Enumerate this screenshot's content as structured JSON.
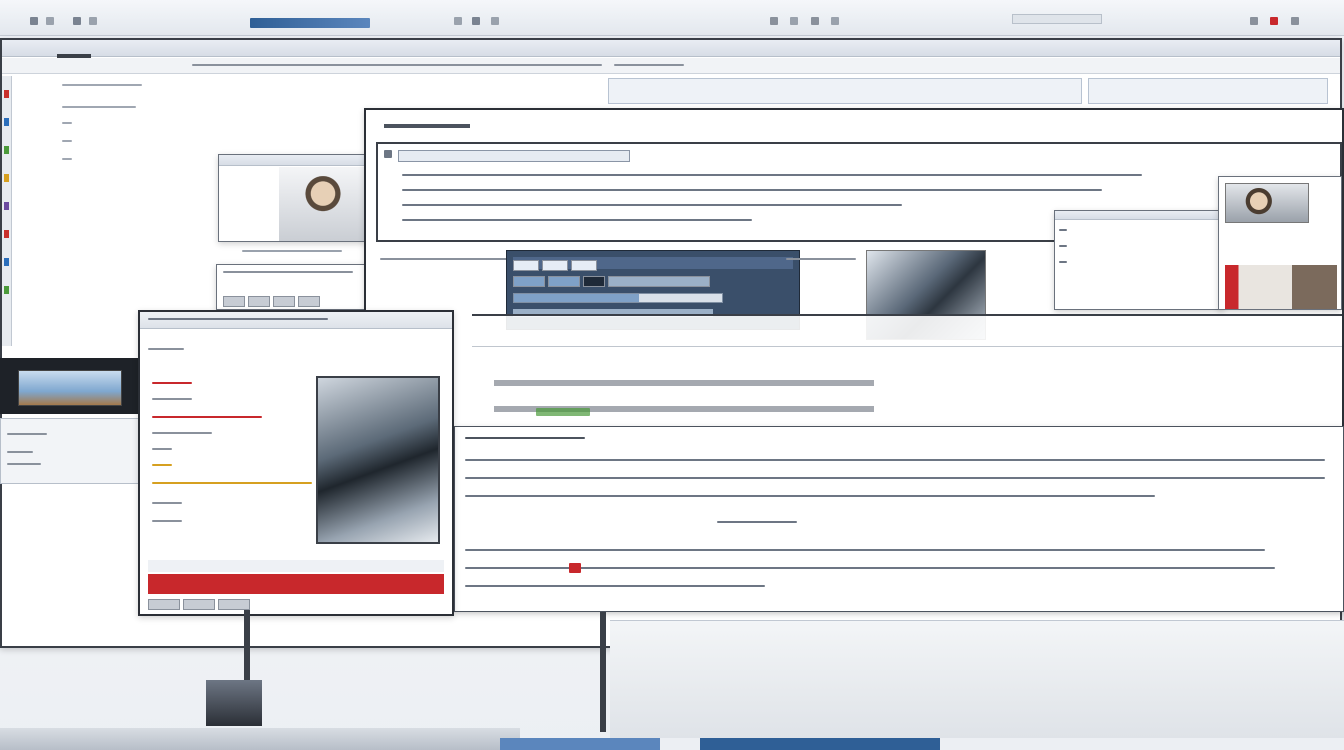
{
  "top_toolbar": {
    "left_text": "",
    "icons": [
      "back-icon",
      "forward-icon",
      "home-icon",
      "page-icon",
      "folder-icon",
      "mail-icon",
      "print-icon",
      "refresh-icon"
    ],
    "right_icons": [
      "search-icon",
      "star-icon",
      "settings-icon",
      "close-icon"
    ]
  },
  "background_window": {
    "menu_text": "",
    "sidebar_colors": [
      "#c9302c",
      "#2a6ebb",
      "#4a9a3a",
      "#d6a020",
      "#6b4aa0",
      "#c9302c",
      "#2a6ebb",
      "#4a9a3a"
    ]
  },
  "main_document": {
    "section_heading": "",
    "link_line": "",
    "intro_lines": [],
    "caption_line": "",
    "headline_1": "",
    "headline_2": "",
    "subhead": "",
    "body_paragraph_1": [],
    "centered_caption": "",
    "body_paragraph_2": []
  },
  "colors": {
    "accent_blue": "#2f5f96",
    "accent_red": "#c8282c",
    "window_border": "#2b2f36",
    "panel_dark": "#3a4f6a"
  }
}
